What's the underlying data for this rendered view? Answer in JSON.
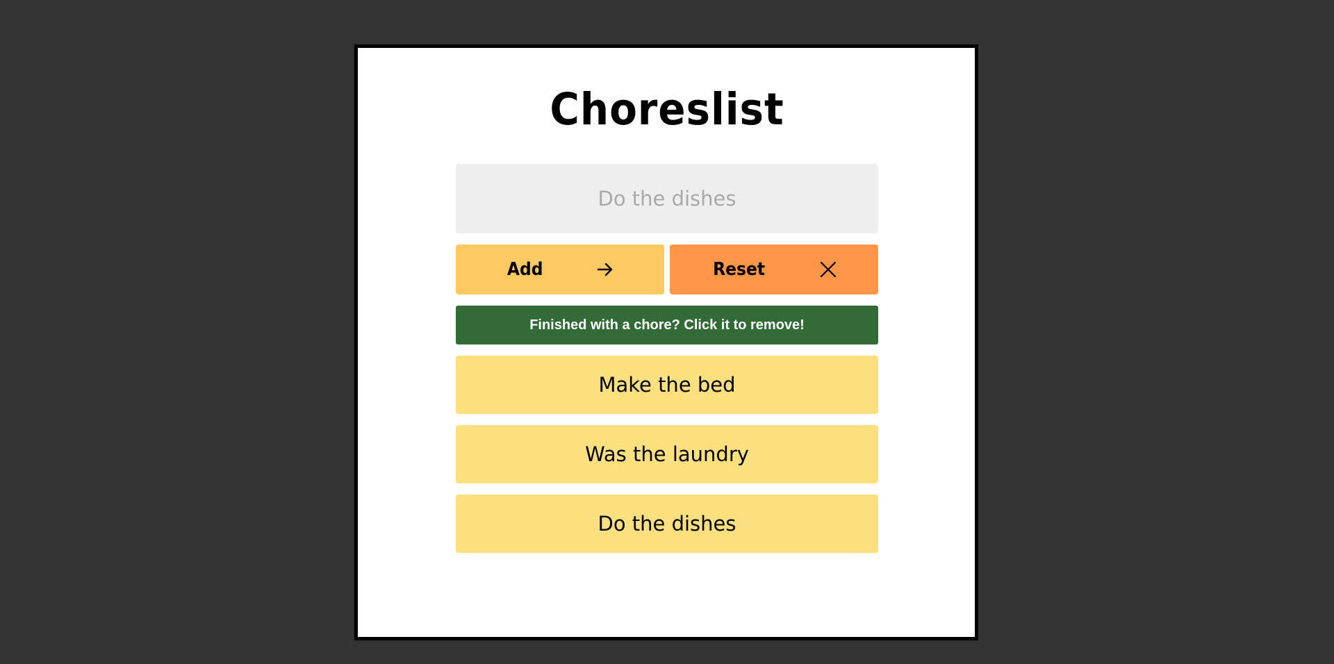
{
  "app": {
    "title": "Choreslist"
  },
  "input": {
    "placeholder": "Do the dishes",
    "value": ""
  },
  "buttons": {
    "add_label": "Add",
    "add_icon": "arrow-right-icon",
    "reset_label": "Reset",
    "reset_icon": "close-icon"
  },
  "banner": {
    "text": "Finished with a chore? Click it to remove!"
  },
  "chores": [
    "Make the bed",
    "Was the laundry",
    "Do the dishes"
  ],
  "colors": {
    "background": "#333333",
    "card": "#ffffff",
    "input_bg": "#eeeeee",
    "add_button": "#ffc961",
    "reset_button": "#ff9648",
    "banner": "#336b37",
    "chore_item": "#fcdf7e"
  }
}
